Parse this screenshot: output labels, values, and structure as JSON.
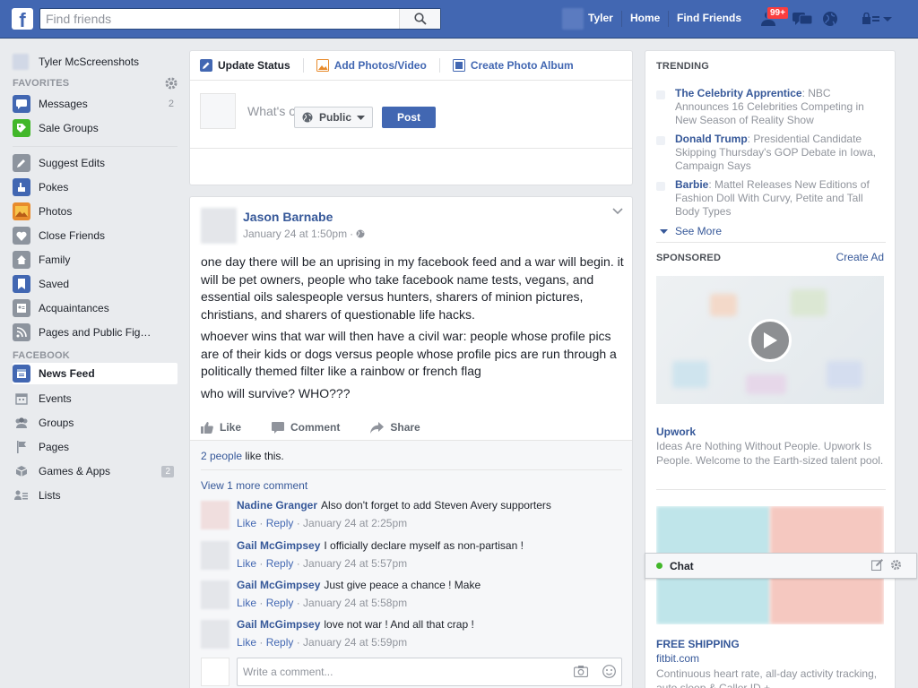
{
  "topbar": {
    "logo": "f",
    "search_placeholder": "Find friends",
    "user": "Tyler",
    "home": "Home",
    "find_friends": "Find Friends",
    "notif_badge": "99+",
    "brand_color": "#4267b2"
  },
  "left": {
    "profile_name": "Tyler McScreenshots",
    "favorites_head": "FAVORITES",
    "favorites": [
      {
        "label": "Messages",
        "count": "2",
        "icon": "messages-icon"
      },
      {
        "label": "Sale Groups",
        "icon": "sale-groups-icon"
      }
    ],
    "lists": [
      {
        "label": "Suggest Edits",
        "icon": "pencil-icon"
      },
      {
        "label": "Pokes",
        "icon": "poke-icon"
      },
      {
        "label": "Photos",
        "icon": "photos-icon"
      },
      {
        "label": "Close Friends",
        "icon": "heart-icon"
      },
      {
        "label": "Family",
        "icon": "house-icon"
      },
      {
        "label": "Saved",
        "icon": "bookmark-icon"
      },
      {
        "label": "Acquaintances",
        "icon": "acquaintances-icon"
      },
      {
        "label": "Pages and Public Fig…",
        "icon": "rss-icon"
      }
    ],
    "facebook_head": "FACEBOOK",
    "facebook": [
      {
        "label": "News Feed",
        "icon": "news-feed-icon"
      },
      {
        "label": "Events",
        "icon": "calendar-icon"
      },
      {
        "label": "Groups",
        "icon": "groups-icon"
      },
      {
        "label": "Pages",
        "icon": "flag-icon"
      },
      {
        "label": "Games & Apps",
        "count": "2",
        "icon": "cube-icon"
      },
      {
        "label": "Lists",
        "icon": "lists-icon"
      }
    ]
  },
  "composer": {
    "tab_status": "Update Status",
    "tab_photos": "Add Photos/Video",
    "tab_album": "Create Photo Album",
    "placeholder": "What's on your mind?",
    "audience": "Public",
    "post": "Post"
  },
  "post": {
    "author": "Jason Barnabe",
    "date": "January 24 at 1:50pm",
    "paragraphs": [
      "one day there will be an uprising in my facebook feed and a war will begin. it will be pet owners, people who take facebook name tests, vegans, and essential oils salespeople versus hunters, sharers of minion pictures, christians, and sharers of questionable life hacks.",
      "whoever wins that war will then have a civil war: people whose profile pics are of their kids or dogs versus people whose profile pics are run through a politically themed filter like a rainbow or french flag",
      "who will survive? WHO???"
    ],
    "like": "Like",
    "comment": "Comment",
    "share": "Share",
    "likes_link": "2 people",
    "likes_rest": "like this.",
    "more_comments": "View 1 more comment",
    "comments": [
      {
        "name": "Nadine Granger",
        "text": "Also don't forget to add Steven Avery supporters",
        "like": "Like",
        "reply": "Reply",
        "time": "January 24 at 2:25pm"
      },
      {
        "name": "Gail McGimpsey",
        "text": "I officially declare myself as non-partisan !",
        "like": "Like",
        "reply": "Reply",
        "time": "January 24 at 5:57pm"
      },
      {
        "name": "Gail McGimpsey",
        "text": "Just give peace a chance ! Make",
        "like": "Like",
        "reply": "Reply",
        "time": "January 24 at 5:58pm"
      },
      {
        "name": "Gail McGimpsey",
        "text": "love not war ! And all that crap !",
        "like": "Like",
        "reply": "Reply",
        "time": "January 24 at 5:59pm"
      }
    ],
    "write_placeholder": "Write a comment..."
  },
  "right": {
    "trending_head": "TRENDING",
    "trending": [
      {
        "name": "The Celebrity Apprentice",
        "text": ": NBC Announces 16 Celebrities Competing in New Season of Reality Show"
      },
      {
        "name": "Donald Trump",
        "text": ": Presidential Candidate Skipping Thursday's GOP Debate in Iowa, Campaign Says"
      },
      {
        "name": "Barbie",
        "text": ": Mattel Releases New Editions of Fashion Doll With Curvy, Petite and Tall Body Types"
      }
    ],
    "see_more": "See More",
    "sponsored_head": "SPONSORED",
    "create_ad": "Create Ad",
    "ad1_title": "Upwork",
    "ad1_desc": "Ideas Are Nothing Without People. Upwork Is People. Welcome to the Earth-sized talent pool.",
    "ad2_title": "FREE SHIPPING",
    "ad2_site": "fitbit.com",
    "ad2_desc": "Continuous heart rate, all-day activity tracking, auto sleep & Caller ID +"
  },
  "chat": {
    "label": "Chat"
  }
}
